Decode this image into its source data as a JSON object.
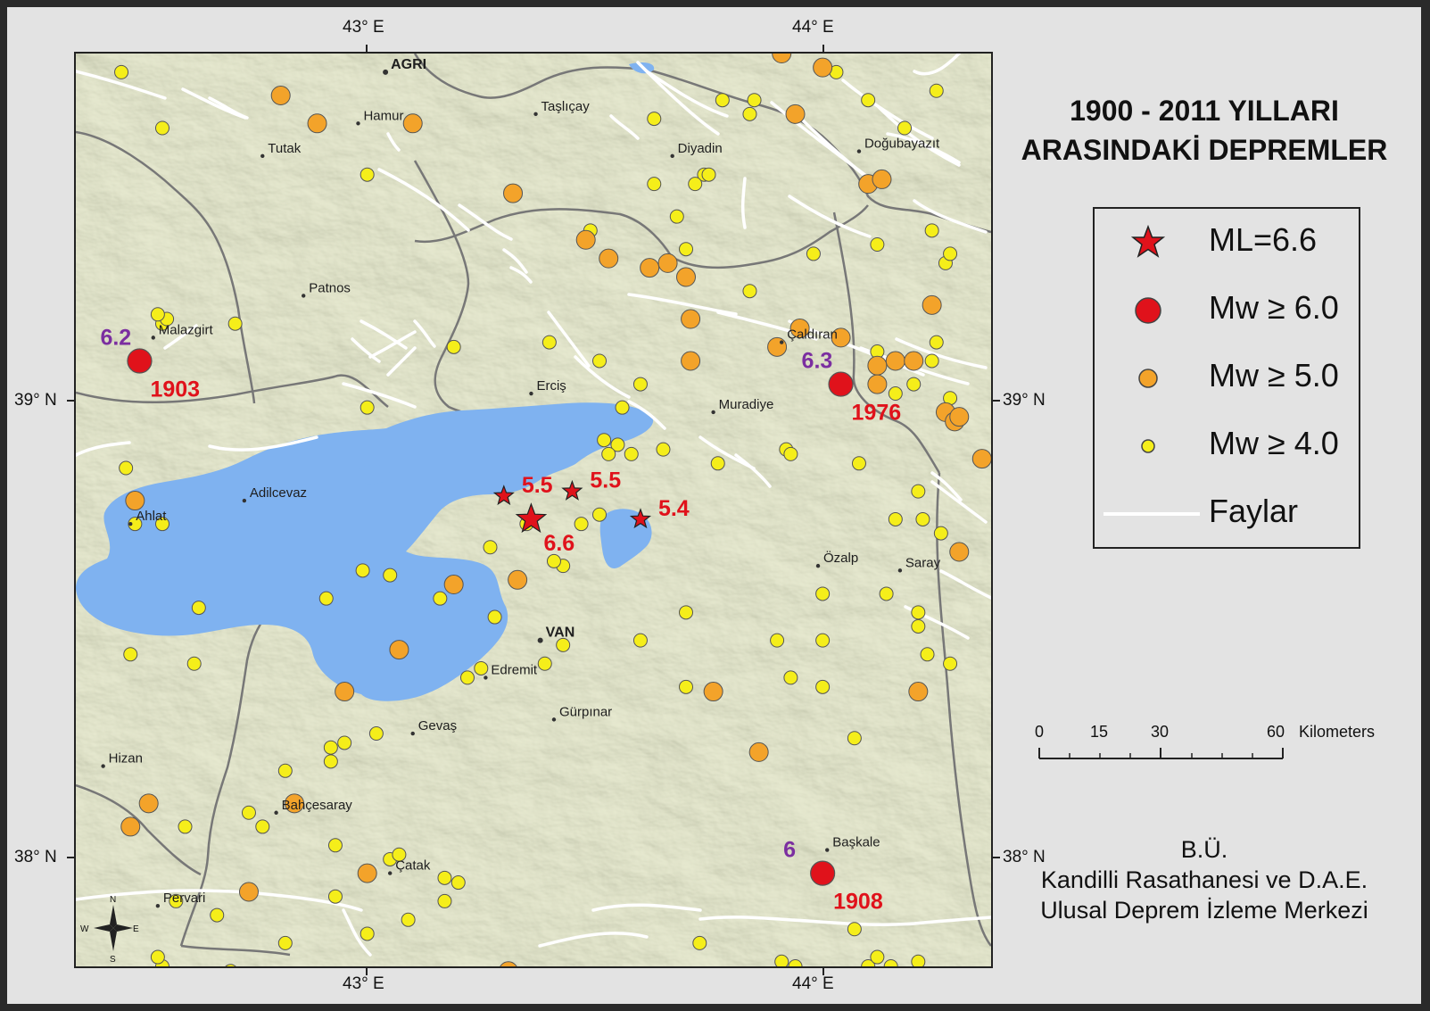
{
  "title": {
    "line1": "1900 - 2011 YILLARI",
    "line2": "ARASINDAKİ DEPREMLER"
  },
  "axes": {
    "lon_labels": [
      "43° E",
      "44° E"
    ],
    "lat_labels": [
      "39° N",
      "38° N"
    ],
    "lon_range": [
      42.36,
      44.37
    ],
    "lat_range": [
      37.8,
      39.76
    ]
  },
  "legend": {
    "items": [
      {
        "symbol": "star",
        "label": "ML=6.6",
        "color": "#e0121b"
      },
      {
        "symbol": "circle-large",
        "label": "Mw ≥ 6.0",
        "color": "#e0121b"
      },
      {
        "symbol": "circle-medium",
        "label": "Mw ≥ 5.0",
        "color": "#f3a32a"
      },
      {
        "symbol": "circle-small",
        "label": "Mw ≥ 4.0",
        "color": "#f5ee1a"
      },
      {
        "symbol": "line",
        "label": "Faylar",
        "color": "#ffffff"
      }
    ]
  },
  "scale_bar": {
    "ticks": [
      "0",
      "15",
      "30",
      "60"
    ],
    "unit": "Kilometers"
  },
  "credits": {
    "line1": "B.Ü.",
    "line2": "Kandilli Rasathanesi ve D.A.E.",
    "line3": "Ulusal Deprem İzleme Merkezi"
  },
  "compass": {
    "n": "N",
    "s": "S",
    "e": "E",
    "w": "W"
  },
  "colors": {
    "terrain": "#c4c7a0",
    "lake": "#7fb2f0",
    "border": "#777777",
    "fault": "#ffffff",
    "mw6": "#e0121b",
    "mw5": "#f3a32a",
    "mw4": "#f5ee1a",
    "label_red": "#e0121b",
    "label_purple": "#7b2ea0"
  },
  "places": [
    {
      "name": "AGRI",
      "lon": 43.04,
      "lat": 39.72,
      "bold": true
    },
    {
      "name": "Taşlıçay",
      "lon": 43.37,
      "lat": 39.63
    },
    {
      "name": "Hamur",
      "lon": 42.98,
      "lat": 39.61
    },
    {
      "name": "Tutak",
      "lon": 42.77,
      "lat": 39.54
    },
    {
      "name": "Diyadin",
      "lon": 43.67,
      "lat": 39.54
    },
    {
      "name": "Doğubayazıt",
      "lon": 44.08,
      "lat": 39.55
    },
    {
      "name": "Patnos",
      "lon": 42.86,
      "lat": 39.24
    },
    {
      "name": "Malazgirt",
      "lon": 42.53,
      "lat": 39.15
    },
    {
      "name": "Çaldıran",
      "lon": 43.91,
      "lat": 39.14
    },
    {
      "name": "Erciş",
      "lon": 43.36,
      "lat": 39.03
    },
    {
      "name": "Muradiye",
      "lon": 43.76,
      "lat": 38.99
    },
    {
      "name": "Adilcevaz",
      "lon": 42.73,
      "lat": 38.8
    },
    {
      "name": "Ahlat",
      "lon": 42.48,
      "lat": 38.75
    },
    {
      "name": "Özalp",
      "lon": 43.99,
      "lat": 38.66
    },
    {
      "name": "Saray",
      "lon": 44.17,
      "lat": 38.65
    },
    {
      "name": "VAN",
      "lon": 43.38,
      "lat": 38.5,
      "bold": true
    },
    {
      "name": "Edremit",
      "lon": 43.26,
      "lat": 38.42
    },
    {
      "name": "Gürpınar",
      "lon": 43.41,
      "lat": 38.33
    },
    {
      "name": "Gevaş",
      "lon": 43.1,
      "lat": 38.3
    },
    {
      "name": "Hizan",
      "lon": 42.42,
      "lat": 38.23
    },
    {
      "name": "Bahçesaray",
      "lon": 42.8,
      "lat": 38.13
    },
    {
      "name": "Başkale",
      "lon": 44.01,
      "lat": 38.05
    },
    {
      "name": "Çatak",
      "lon": 43.05,
      "lat": 38.0
    },
    {
      "name": "Pervari",
      "lon": 42.54,
      "lat": 37.93
    }
  ],
  "events_major": [
    {
      "lon": 42.5,
      "lat": 39.1,
      "mag": "6.2",
      "year": "1903"
    },
    {
      "lon": 44.04,
      "lat": 39.05,
      "mag": "6.3",
      "year": "1976"
    },
    {
      "lon": 44.0,
      "lat": 38.0,
      "mag": "6",
      "year": "1908"
    }
  ],
  "stars": [
    {
      "lon": 43.36,
      "lat": 38.76,
      "label": "6.6",
      "main": true
    },
    {
      "lon": 43.3,
      "lat": 38.81,
      "label": "5.5"
    },
    {
      "lon": 43.45,
      "lat": 38.82,
      "label": "5.5"
    },
    {
      "lon": 43.6,
      "lat": 38.76,
      "label": "5.4"
    }
  ],
  "events_mw5": [
    [
      42.81,
      39.67
    ],
    [
      42.89,
      39.61
    ],
    [
      43.1,
      39.61
    ],
    [
      43.32,
      39.46
    ],
    [
      43.48,
      39.36
    ],
    [
      43.53,
      39.32
    ],
    [
      43.62,
      39.3
    ],
    [
      43.66,
      39.31
    ],
    [
      43.7,
      39.28
    ],
    [
      43.71,
      39.19
    ],
    [
      43.71,
      39.1
    ],
    [
      43.9,
      39.13
    ],
    [
      43.95,
      39.17
    ],
    [
      44.04,
      39.15
    ],
    [
      44.12,
      39.09
    ],
    [
      44.16,
      39.1
    ],
    [
      44.2,
      39.1
    ],
    [
      44.24,
      39.22
    ],
    [
      44.1,
      39.48
    ],
    [
      44.13,
      39.49
    ],
    [
      44.27,
      38.99
    ],
    [
      44.29,
      38.97
    ],
    [
      44.3,
      38.98
    ],
    [
      44.35,
      38.89
    ],
    [
      44.3,
      38.69
    ],
    [
      42.49,
      38.8
    ],
    [
      43.19,
      38.62
    ],
    [
      43.33,
      38.63
    ],
    [
      43.07,
      38.48
    ],
    [
      42.95,
      38.39
    ],
    [
      43.76,
      38.39
    ],
    [
      44.21,
      38.39
    ],
    [
      43.86,
      38.26
    ],
    [
      42.52,
      38.15
    ],
    [
      42.48,
      38.1
    ],
    [
      42.84,
      38.15
    ],
    [
      42.74,
      37.96
    ],
    [
      43.0,
      38.0
    ],
    [
      43.31,
      37.79
    ],
    [
      43.91,
      39.76
    ],
    [
      44.0,
      39.73
    ],
    [
      43.94,
      39.63
    ],
    [
      44.12,
      39.05
    ]
  ],
  "events_mw4": [
    [
      42.46,
      39.72
    ],
    [
      42.55,
      39.6
    ],
    [
      43.0,
      39.5
    ],
    [
      43.63,
      39.62
    ],
    [
      43.78,
      39.66
    ],
    [
      43.85,
      39.66
    ],
    [
      43.84,
      39.63
    ],
    [
      44.03,
      39.72
    ],
    [
      44.1,
      39.66
    ],
    [
      44.18,
      39.6
    ],
    [
      44.25,
      39.68
    ],
    [
      43.68,
      39.41
    ],
    [
      43.7,
      39.34
    ],
    [
      43.74,
      39.5
    ],
    [
      43.75,
      39.5
    ],
    [
      43.63,
      39.48
    ],
    [
      43.72,
      39.48
    ],
    [
      43.49,
      39.38
    ],
    [
      43.84,
      39.25
    ],
    [
      43.98,
      39.33
    ],
    [
      44.12,
      39.35
    ],
    [
      44.24,
      39.38
    ],
    [
      44.27,
      39.31
    ],
    [
      44.28,
      39.33
    ],
    [
      44.25,
      39.14
    ],
    [
      44.24,
      39.1
    ],
    [
      44.2,
      39.05
    ],
    [
      44.12,
      39.12
    ],
    [
      44.16,
      39.03
    ],
    [
      44.28,
      39.02
    ],
    [
      43.56,
      39.0
    ],
    [
      43.51,
      39.1
    ],
    [
      43.6,
      39.05
    ],
    [
      43.4,
      39.14
    ],
    [
      43.19,
      39.13
    ],
    [
      42.71,
      39.18
    ],
    [
      42.55,
      39.18
    ],
    [
      42.56,
      39.19
    ],
    [
      43.0,
      39.0
    ],
    [
      43.55,
      38.92
    ],
    [
      43.65,
      38.91
    ],
    [
      43.77,
      38.88
    ],
    [
      43.92,
      38.91
    ],
    [
      43.93,
      38.9
    ],
    [
      44.08,
      38.88
    ],
    [
      44.21,
      38.82
    ],
    [
      44.22,
      38.76
    ],
    [
      44.16,
      38.76
    ],
    [
      44.26,
      38.73
    ],
    [
      44.14,
      38.6
    ],
    [
      44.0,
      38.6
    ],
    [
      44.21,
      38.56
    ],
    [
      44.21,
      38.53
    ],
    [
      44.23,
      38.47
    ],
    [
      44.28,
      38.45
    ],
    [
      43.9,
      38.5
    ],
    [
      44.0,
      38.5
    ],
    [
      43.93,
      38.42
    ],
    [
      44.0,
      38.4
    ],
    [
      44.07,
      38.29
    ],
    [
      43.7,
      38.4
    ],
    [
      43.7,
      38.56
    ],
    [
      43.6,
      38.5
    ],
    [
      43.43,
      38.66
    ],
    [
      43.41,
      38.67
    ],
    [
      43.35,
      38.75
    ],
    [
      43.27,
      38.7
    ],
    [
      43.28,
      38.55
    ],
    [
      43.39,
      38.45
    ],
    [
      43.43,
      38.49
    ],
    [
      43.25,
      38.44
    ],
    [
      43.22,
      38.42
    ],
    [
      43.16,
      38.59
    ],
    [
      42.91,
      38.59
    ],
    [
      42.99,
      38.65
    ],
    [
      42.63,
      38.57
    ],
    [
      42.62,
      38.45
    ],
    [
      42.48,
      38.47
    ],
    [
      42.47,
      38.87
    ],
    [
      42.55,
      38.75
    ],
    [
      42.33,
      38.14
    ],
    [
      42.6,
      38.1
    ],
    [
      42.74,
      38.13
    ],
    [
      42.77,
      38.1
    ],
    [
      42.82,
      38.22
    ],
    [
      42.92,
      38.24
    ],
    [
      42.92,
      38.27
    ],
    [
      42.95,
      38.28
    ],
    [
      43.02,
      38.3
    ],
    [
      42.93,
      38.06
    ],
    [
      42.93,
      37.95
    ],
    [
      43.0,
      37.87
    ],
    [
      43.05,
      38.03
    ],
    [
      43.07,
      38.04
    ],
    [
      43.09,
      37.9
    ],
    [
      43.17,
      37.99
    ],
    [
      43.17,
      37.94
    ],
    [
      43.2,
      37.98
    ],
    [
      42.55,
      37.8
    ],
    [
      42.58,
      37.94
    ],
    [
      42.67,
      37.91
    ],
    [
      42.7,
      37.79
    ],
    [
      42.82,
      37.85
    ],
    [
      42.54,
      37.82
    ],
    [
      43.73,
      37.85
    ],
    [
      43.81,
      37.78
    ],
    [
      43.91,
      37.81
    ],
    [
      43.9,
      37.78
    ],
    [
      43.94,
      37.8
    ],
    [
      43.97,
      37.77
    ],
    [
      44.07,
      37.88
    ],
    [
      44.1,
      37.8
    ],
    [
      44.12,
      37.82
    ],
    [
      44.15,
      37.8
    ],
    [
      44.21,
      37.81
    ],
    [
      43.52,
      38.93
    ],
    [
      43.53,
      38.9
    ],
    [
      43.58,
      38.9
    ],
    [
      42.54,
      39.2
    ],
    [
      43.51,
      38.77
    ],
    [
      43.47,
      38.75
    ],
    [
      43.05,
      38.64
    ],
    [
      42.49,
      38.75
    ]
  ]
}
